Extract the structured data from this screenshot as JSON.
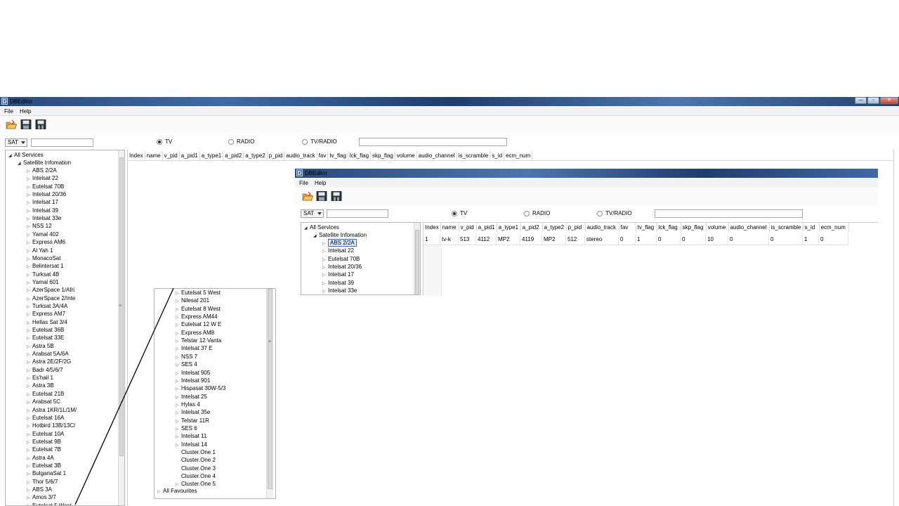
{
  "window": {
    "title": "DBEditor",
    "app_icon_letter": "D",
    "controls": [
      "—",
      "▫",
      "✕"
    ]
  },
  "menu": {
    "file": "File",
    "help": "Help"
  },
  "toolbar": {
    "icons": [
      "open-folder-icon",
      "save-icon",
      "save-as-icon"
    ]
  },
  "filter": {
    "type_select": "SAT",
    "radio_tv": "TV",
    "radio_radio": "RADIO",
    "radio_tvradio": "TV/RADIO",
    "selected": "TV"
  },
  "tree": {
    "root": "All Services",
    "group": "Satellite Infomation",
    "satellites": [
      "ABS 2/2A",
      "Intelsat 22",
      "Eutelsat 70B",
      "Intelsat 20/36",
      "Intelsat 17",
      "Intelsat 39",
      "Intelsat 33e",
      "NSS 12",
      "Yamal 402",
      "Express AM6",
      "Al Yah 1",
      "MonacoSat",
      "Belintersat 1",
      "Turksat 4B",
      "Yamal 601",
      "AzerSpace 1/Afri",
      "AzerSpace 2/Inte",
      "Turksat 3A/4A",
      "Express AM7",
      "Hellas Sat 3/4",
      "Eutelsat 36B",
      "Eutelsat 33E",
      "Astra 5B",
      "Arabsat 5A/6A",
      "Astra 2E/2F/2G",
      "Badr 4/5/6/7",
      "Es'hail 1",
      "Astra 3B",
      "Eutelsat 21B",
      "Arabsat 5C",
      "Astra 1KR/1L/1M/",
      "Eutelsat 16A",
      "Hotbird 13B/13C/",
      "Eutelsat 10A",
      "Eutelsat 9B",
      "Eutelsat 7B",
      "Astra 4A",
      "Eutelsat 3B",
      "BulgariaSat 1",
      "Thor 5/6/7",
      "ABS 3A",
      "Amos 3/7",
      "Eutelsat 5 West"
    ]
  },
  "zoom_tree": {
    "items": [
      "Eutelsat 5 West",
      "Nilesat 201",
      "Eutelsat 8 West",
      "Express AM44",
      "Eutelsat 12 W E",
      "Express AM8",
      "Telstar 12 Vanta",
      "Intelsat 37 E",
      "NSS 7",
      "SES 4",
      "Intelsat 905",
      "Intelsat 901",
      "Hispasat 30W-5/3",
      "Intelsat 25",
      "Hylas 4",
      "Intelsat 35e",
      "Telstar 11R",
      "SES 6",
      "Intelsat 11",
      "Intelsat 14",
      "Cluster.One 1",
      "Cluster.One 2",
      "Cluster.One 3",
      "Cluster.One 4",
      "Cluster.One 5"
    ],
    "favourites": "All Favourites"
  },
  "columns": [
    "Index",
    "name",
    "v_pid",
    "a_pid1",
    "a_type1",
    "a_pid2",
    "a_type2",
    "p_pid",
    "audio_track",
    "fav",
    "tv_flag",
    "lck_flag",
    "skp_flag",
    "volume",
    "audio_channel",
    "is_scramble",
    "s_id",
    "ecm_num"
  ],
  "inner": {
    "title": "DBEditor",
    "tree_items": [
      "ABS 2/2A",
      "Intelsat 22",
      "Eutelsat 70B",
      "Intelsat 20/36",
      "Intelsat 17",
      "Intelsat 39",
      "Intelsat 33e"
    ],
    "selected_item": "ABS 2/2A",
    "row": [
      "1",
      "tv-k",
      "513",
      "4112",
      "MP2",
      "4119",
      "MP2",
      "512",
      "stereo",
      "0",
      "1",
      "0",
      "0",
      "10",
      "0",
      "0",
      "1",
      "0"
    ]
  }
}
